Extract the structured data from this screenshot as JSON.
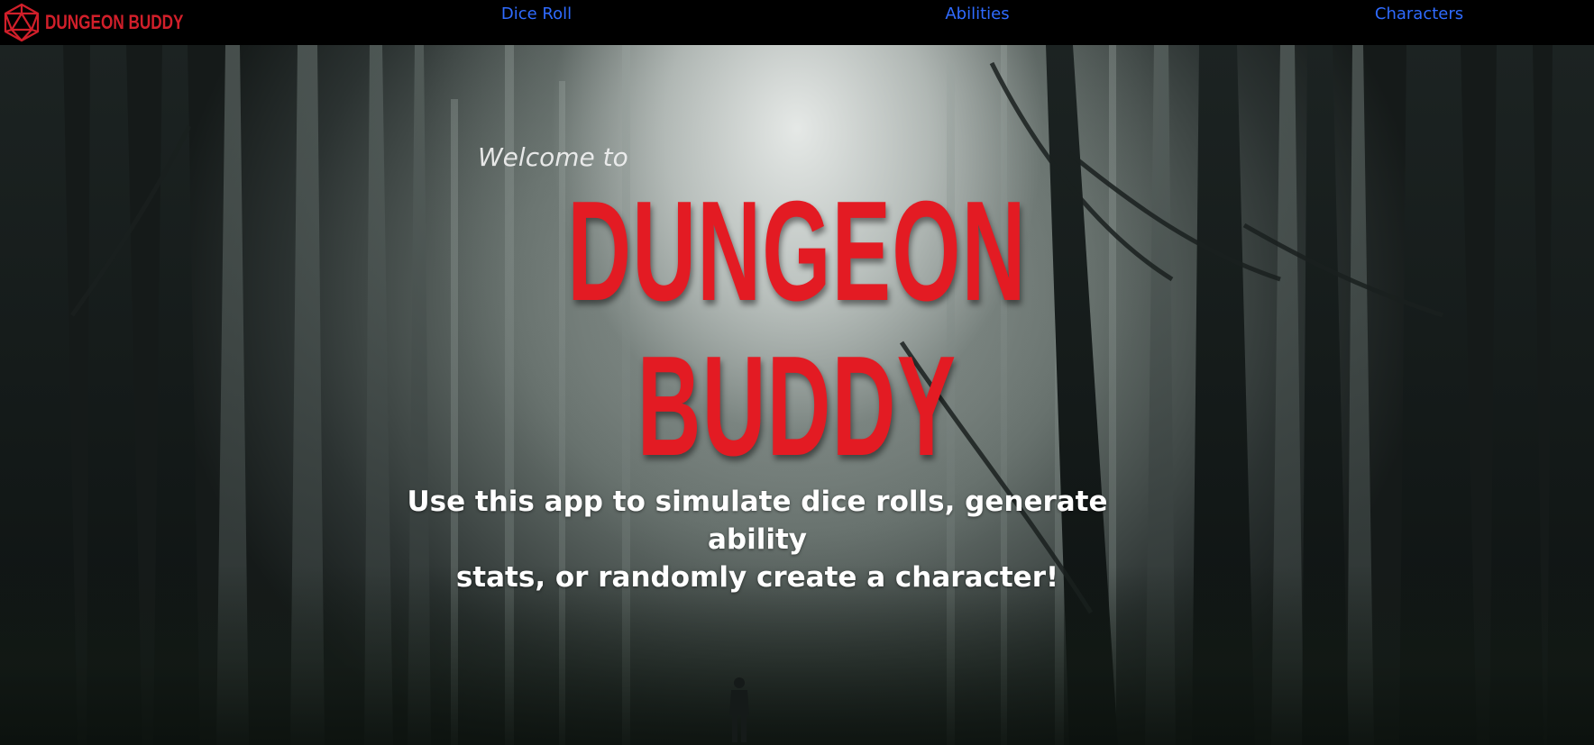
{
  "navbar": {
    "brand": {
      "text": "DUNGEON BUDDY",
      "icon": "d20-die-icon",
      "color": "#d11f2a"
    },
    "links": [
      {
        "label": "Dice Roll"
      },
      {
        "label": "Abilities"
      },
      {
        "label": "Characters"
      }
    ],
    "link_color": "#2f6bff"
  },
  "hero": {
    "welcome": "Welcome to",
    "title_line1": "DUNGEON",
    "title_line2": "BUDDY",
    "title_color": "#e31b23",
    "tagline_line1": "Use this app to simulate dice rolls, generate ability",
    "tagline_line2": "stats, or randomly create a character!",
    "background": "foggy-forest-photo"
  }
}
